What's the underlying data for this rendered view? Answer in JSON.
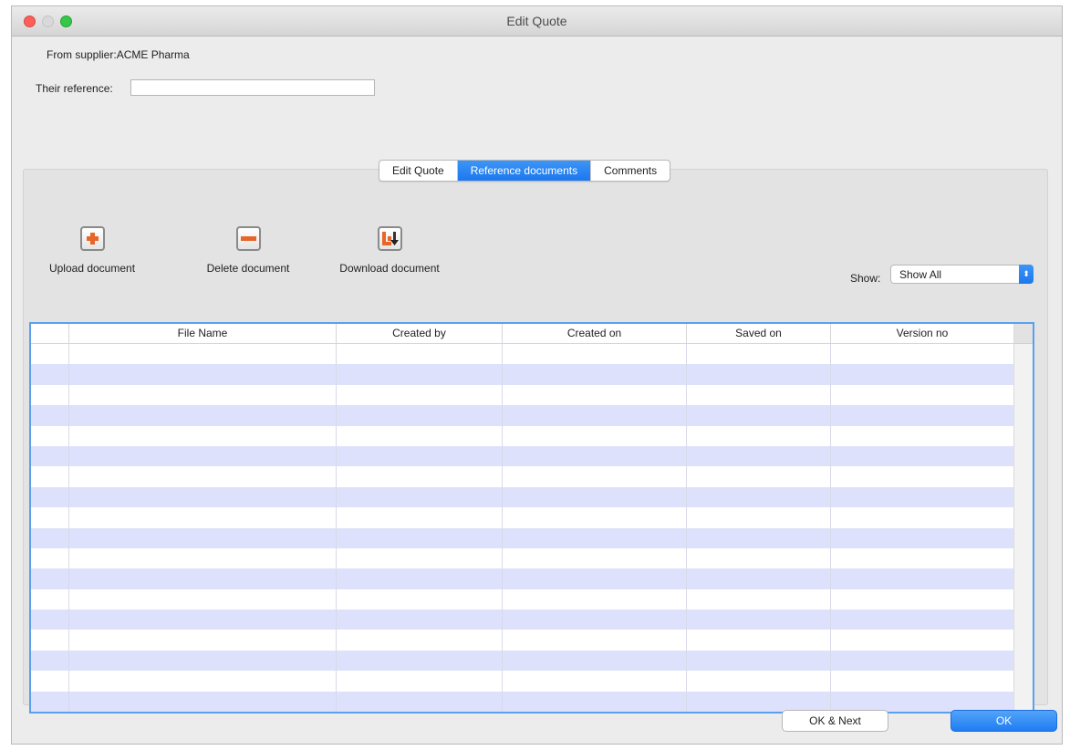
{
  "window": {
    "title": "Edit Quote"
  },
  "header": {
    "supplier_label": "From supplier:",
    "supplier_value": "ACME Pharma",
    "reference_label": "Their reference:",
    "reference_value": ""
  },
  "tabs": [
    {
      "label": "Edit Quote",
      "active": false
    },
    {
      "label": "Reference documents",
      "active": true
    },
    {
      "label": "Comments",
      "active": false
    }
  ],
  "toolbar": {
    "upload_label": "Upload document",
    "delete_label": "Delete document",
    "download_label": "Download document"
  },
  "filter": {
    "label": "Show:",
    "selected": "Show All"
  },
  "table": {
    "columns": [
      "",
      "File Name",
      "Created by",
      "Created on",
      "Saved on",
      "Version no"
    ],
    "rows": []
  },
  "buttons": {
    "ok_next_label": "OK & Next",
    "ok_label": "OK"
  },
  "colors": {
    "accent": "#1c78ef",
    "row_alt": "#dde1fb",
    "table_border": "#5aa0ee"
  }
}
